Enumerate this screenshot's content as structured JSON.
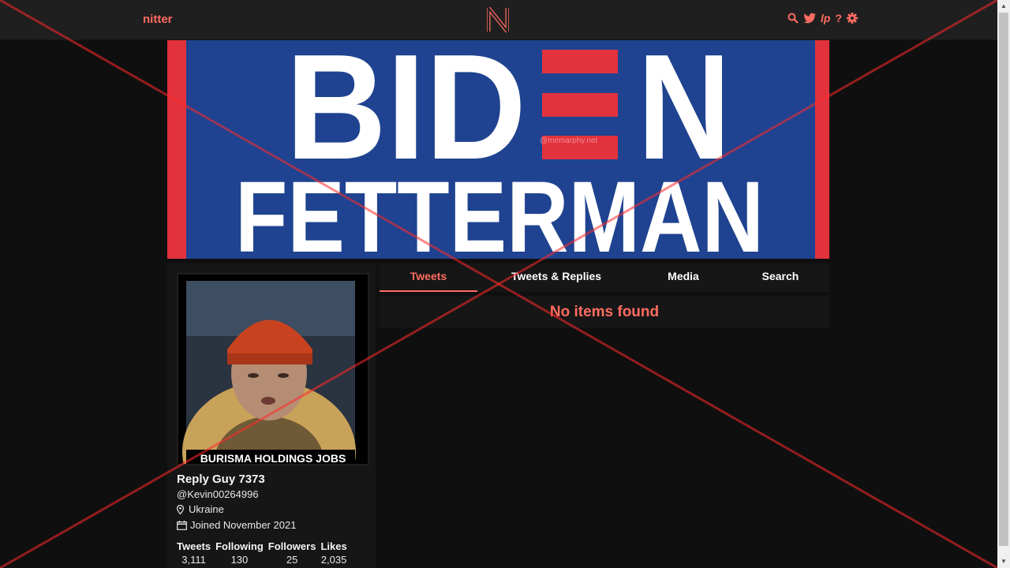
{
  "nav": {
    "brand": "nitter",
    "icons": [
      "search-icon",
      "twitter-icon",
      "lp-icon",
      "help-icon",
      "settings-icon"
    ],
    "lp_text": "lp",
    "help_text": "?"
  },
  "banner": {
    "line1": "BIDEN",
    "line2": "FETTERMAN",
    "watermark": "@memarphy.net",
    "colors": {
      "blue": "#1f4390",
      "red": "#e2323d",
      "white": "#ffffff"
    }
  },
  "profile": {
    "fullname": "Reply Guy 7373",
    "username": "@Kevin00264996",
    "location": "Ukraine",
    "joined": "Joined November 2021",
    "avatar_caption": "BURISMA HOLDINGS JOBS",
    "stats": [
      {
        "label": "Tweets",
        "value": "3,111"
      },
      {
        "label": "Following",
        "value": "130"
      },
      {
        "label": "Followers",
        "value": "25"
      },
      {
        "label": "Likes",
        "value": "2,035"
      }
    ]
  },
  "tabs": [
    {
      "label": "Tweets",
      "active": true
    },
    {
      "label": "Tweets & Replies",
      "active": false
    },
    {
      "label": "Media",
      "active": false
    },
    {
      "label": "Search",
      "active": false
    }
  ],
  "timeline": {
    "empty_message": "No items found"
  },
  "colors": {
    "accent": "#ff6c60",
    "background": "#0f0f0f",
    "panel": "#161616",
    "navbar": "#1f1f1f"
  }
}
